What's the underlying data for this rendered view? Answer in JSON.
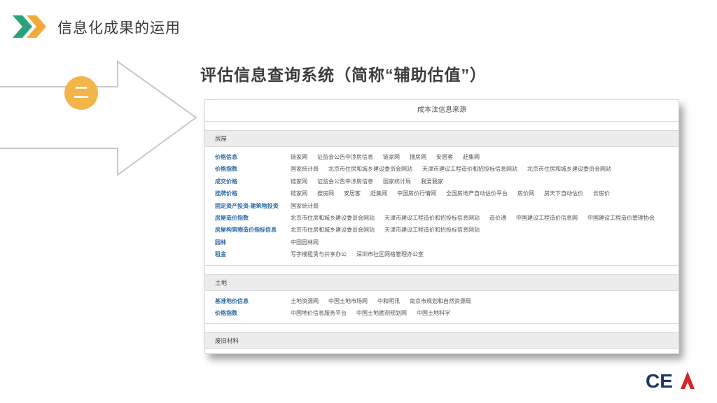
{
  "header": {
    "title": "信息化成果的运用"
  },
  "badge": {
    "number": "二"
  },
  "main": {
    "title": "评估信息查询系统（简称“辅助估值”）"
  },
  "panel": {
    "title": "成本法信息来源",
    "sections": [
      {
        "title": "房屋",
        "rows": [
          {
            "label": "价格信息",
            "links": [
              "链家网",
              "证监会公告中涉房信息",
              "链家网",
              "搜房网",
              "安居客",
              "赶集网"
            ]
          },
          {
            "label": "价格指数",
            "links": [
              "国家统计局",
              "北京市住房和城乡建设委员会网站",
              "天津市建设工程造价和招投标信息网站",
              "北京市住房和城乡建设委员会网站"
            ]
          },
          {
            "label": "成交价格",
            "links": [
              "链家网",
              "证监会公告中涉房信息",
              "国家统计局",
              "我爱我家"
            ]
          },
          {
            "label": "挂牌价格",
            "links": [
              "链家网",
              "搜房网",
              "安居客",
              "赶集网",
              "中国房价行情网",
              "全国房地产自动估价平台",
              "房价网",
              "房天下自动估价",
              "云房价"
            ]
          },
          {
            "label": "固定资产投资-建筑物投资",
            "links": [
              "国家统计局"
            ]
          },
          {
            "label": "房屋造价指数",
            "links": [
              "北京市住房和城乡建设委员会网站",
              "天津市建设工程造价和招投标信息网站",
              "造价通",
              "中国建设工程造价信息网",
              "中国建设工程造价管理协会"
            ]
          },
          {
            "label": "房屋构筑物造价指标信息",
            "links": [
              "北京市住房和城乡建设委员会网站",
              "天津市建设工程造价和招投标信息网站"
            ]
          },
          {
            "label": "园林",
            "links": [
              "中国园林网"
            ]
          },
          {
            "label": "租金",
            "links": [
              "写字楼租赁与共享办公",
              "深圳市社区网格管理办公室"
            ]
          }
        ]
      },
      {
        "title": "土地",
        "rows": [
          {
            "label": "基准地价信息",
            "links": [
              "土地资源网",
              "中国土地市场网",
              "中和明讯",
              "南京市规划和自然资源局"
            ]
          },
          {
            "label": "价格指数",
            "links": [
              "中国地价信息服务平台",
              "中国土地勘测规划网",
              "中国土地科学"
            ]
          }
        ]
      },
      {
        "title": "废旧材料",
        "rows": []
      }
    ]
  },
  "logo": {
    "text": "CEA"
  },
  "colors": {
    "accent_green": "#2aa37a",
    "accent_orange": "#f3b54a",
    "link_blue": "#2f6ea8",
    "logo_red": "#d6242b",
    "logo_navy": "#1f3566"
  }
}
